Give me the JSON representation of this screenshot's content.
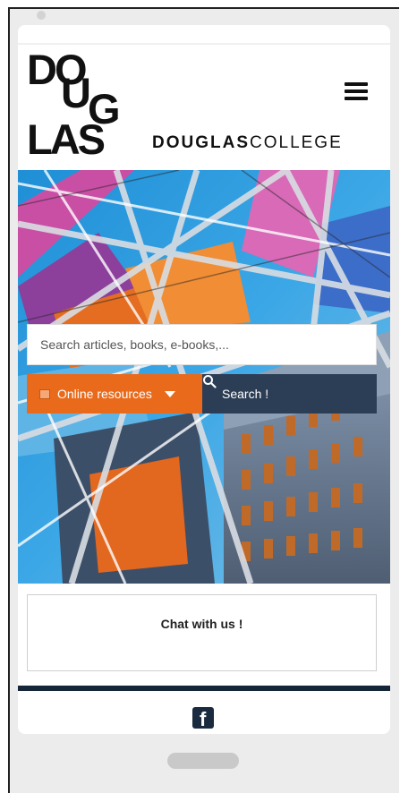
{
  "header": {
    "logo_letters": [
      "DO",
      "U",
      "G",
      "LAS"
    ],
    "wordmark_bold": "DOUGLAS",
    "wordmark_light": "COLLEGE"
  },
  "search": {
    "placeholder": "Search articles, books, e-books,...",
    "resources_label": "Online resources",
    "search_label": "Search !"
  },
  "chat": {
    "label": "Chat with us !"
  },
  "footer": {
    "facebook_glyph": "f"
  },
  "colors": {
    "accent_orange": "#ea6a1c",
    "navy": "#2c3e55",
    "rule": "#142638"
  },
  "icons": [
    "menu-icon",
    "book-icon",
    "caret-down-icon",
    "search-icon",
    "facebook-icon"
  ]
}
